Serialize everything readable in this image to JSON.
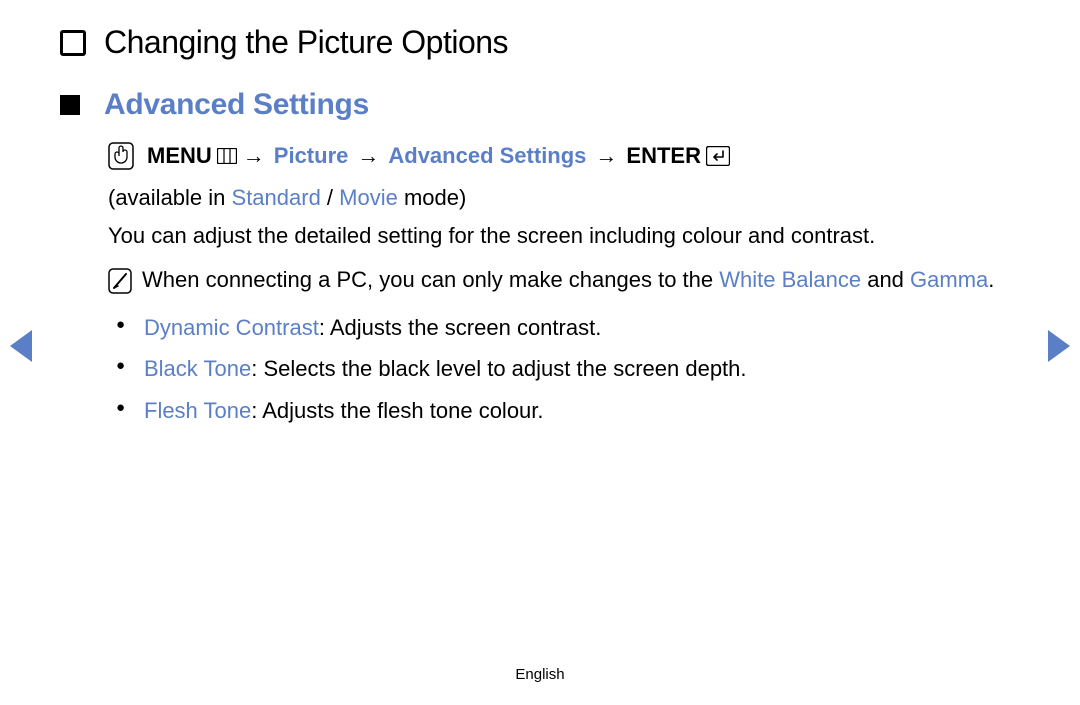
{
  "title": "Changing the Picture Options",
  "section": "Advanced Settings",
  "nav": {
    "menu_label": "MENU",
    "picture": "Picture",
    "advanced": "Advanced Settings",
    "enter_label": "ENTER",
    "arrow": "→"
  },
  "availability": {
    "prefix": "(available in ",
    "standard": "Standard",
    "slash": " / ",
    "movie": "Movie",
    "suffix": " mode)"
  },
  "description": "You can adjust the detailed setting for the screen including colour and contrast.",
  "note": {
    "part1": "When connecting a PC, you can only make changes to the ",
    "white_balance": "White Balance",
    "and": " and ",
    "gamma": "Gamma",
    "period": "."
  },
  "bullets": [
    {
      "label": "Dynamic Contrast",
      "text": ": Adjusts the screen contrast."
    },
    {
      "label": "Black Tone",
      "text": ": Selects the black level to adjust the screen depth."
    },
    {
      "label": "Flesh Tone",
      "text": ": Adjusts the flesh tone colour."
    }
  ],
  "footer_lang": "English"
}
